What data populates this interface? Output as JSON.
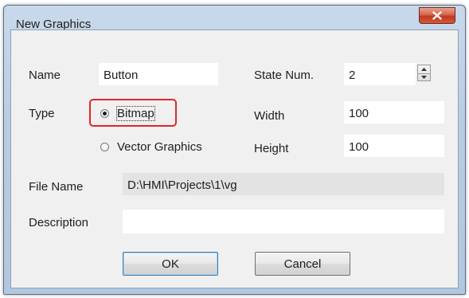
{
  "window": {
    "title": "New Graphics",
    "colors": {
      "titlebar": "#b9cde2",
      "close": "#c2391d",
      "highlight": "#e0262a"
    }
  },
  "form": {
    "name_label": "Name",
    "name_value": "Button",
    "state_label": "State Num.",
    "state_value": "2",
    "type_label": "Type",
    "type_options": [
      {
        "label": "Bitmap",
        "selected": true
      },
      {
        "label": "Vector Graphics",
        "selected": false
      }
    ],
    "width_label": "Width",
    "width_value": "100",
    "height_label": "Height",
    "height_value": "100",
    "file_label": "File Name",
    "file_value": "D:\\HMI\\Projects\\1\\vg",
    "description_label": "Description",
    "description_value": ""
  },
  "buttons": {
    "ok": "OK",
    "cancel": "Cancel"
  }
}
